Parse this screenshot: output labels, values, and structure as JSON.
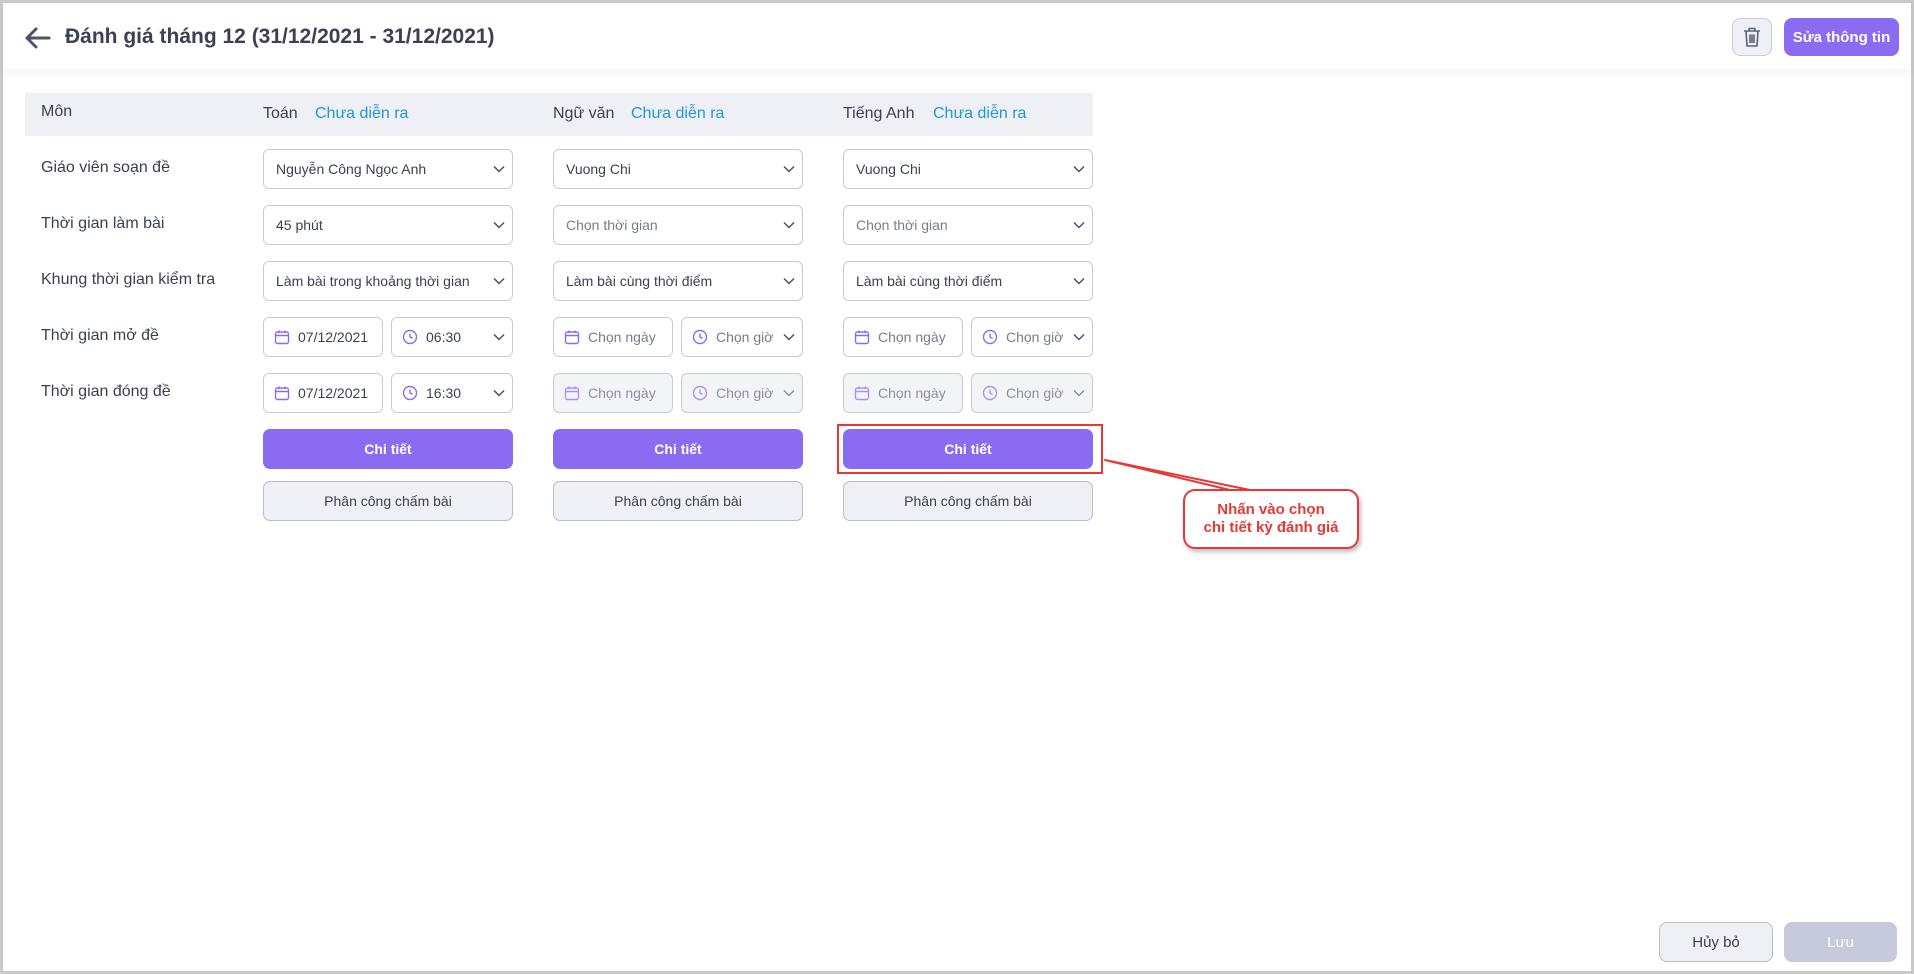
{
  "header": {
    "title": "Đánh giá tháng 12 (31/12/2021 - 31/12/2021)",
    "edit_label": "Sửa thông tin"
  },
  "table": {
    "subject_header": "Môn",
    "row_labels": [
      "Giáo viên soạn đề",
      "Thời gian làm bài",
      "Khung thời gian kiểm tra",
      "Thời gian mở đề",
      "Thời gian đóng đề"
    ],
    "subjects": [
      {
        "name": "Toán",
        "status": "Chưa diễn ra",
        "teacher": "Nguyễn Công Ngọc Anh",
        "duration": "45 phút",
        "frame": "Làm bài trong khoảng thời gian",
        "open_date": "07/12/2021",
        "open_time": "06:30",
        "close_date": "07/12/2021",
        "close_time": "16:30",
        "detail_label": "Chi tiết",
        "assign_label": "Phân công chấm bài"
      },
      {
        "name": "Ngữ văn",
        "status": "Chưa diễn ra",
        "teacher": "Vuong  Chi",
        "duration": "Chọn thời gian",
        "frame": "Làm bài cùng thời điểm",
        "open_date": "Chọn ngày",
        "open_time": "Chọn giờ",
        "close_date": "Chọn ngày",
        "close_time": "Chọn giờ",
        "detail_label": "Chi tiết",
        "assign_label": "Phân công chấm bài"
      },
      {
        "name": "Tiếng Anh",
        "status": "Chưa diễn ra",
        "teacher": "Vuong  Chi",
        "duration": "Chọn thời gian",
        "frame": "Làm bài cùng thời điểm",
        "open_date": "Chọn ngày",
        "open_time": "Chọn giờ",
        "close_date": "Chọn ngày",
        "close_time": "Chọn giờ",
        "detail_label": "Chi tiết",
        "assign_label": "Phân công chấm bài"
      }
    ]
  },
  "annotation": {
    "line1": "Nhấn vào chọn",
    "line2": "chi tiết kỳ đánh giá"
  },
  "footer": {
    "cancel_label": "Hủy bỏ",
    "save_label": "Lưu"
  },
  "colors": {
    "accent": "#8a6cf2",
    "status": "#2196d9",
    "annotation": "#e53935"
  }
}
